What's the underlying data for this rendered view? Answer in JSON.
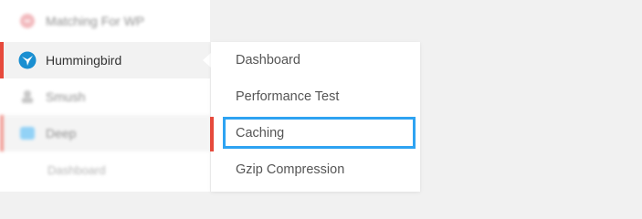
{
  "sidebar": {
    "items": [
      {
        "label": "Matching For WP",
        "icon": "circle-plugin-icon"
      },
      {
        "label": "Hummingbird",
        "icon": "hummingbird-icon"
      },
      {
        "label": "Smush",
        "icon": "smush-icon"
      },
      {
        "label": "Deep",
        "icon": "folder-icon"
      },
      {
        "label": "Dashboard"
      }
    ]
  },
  "submenu": {
    "items": [
      {
        "label": "Dashboard"
      },
      {
        "label": "Performance Test"
      },
      {
        "label": "Caching"
      },
      {
        "label": "Gzip Compression"
      }
    ]
  },
  "colors": {
    "accent_red": "#e64a3c",
    "focus_blue": "#2ea3f2",
    "hummingbird_blue": "#1a8fd1"
  }
}
